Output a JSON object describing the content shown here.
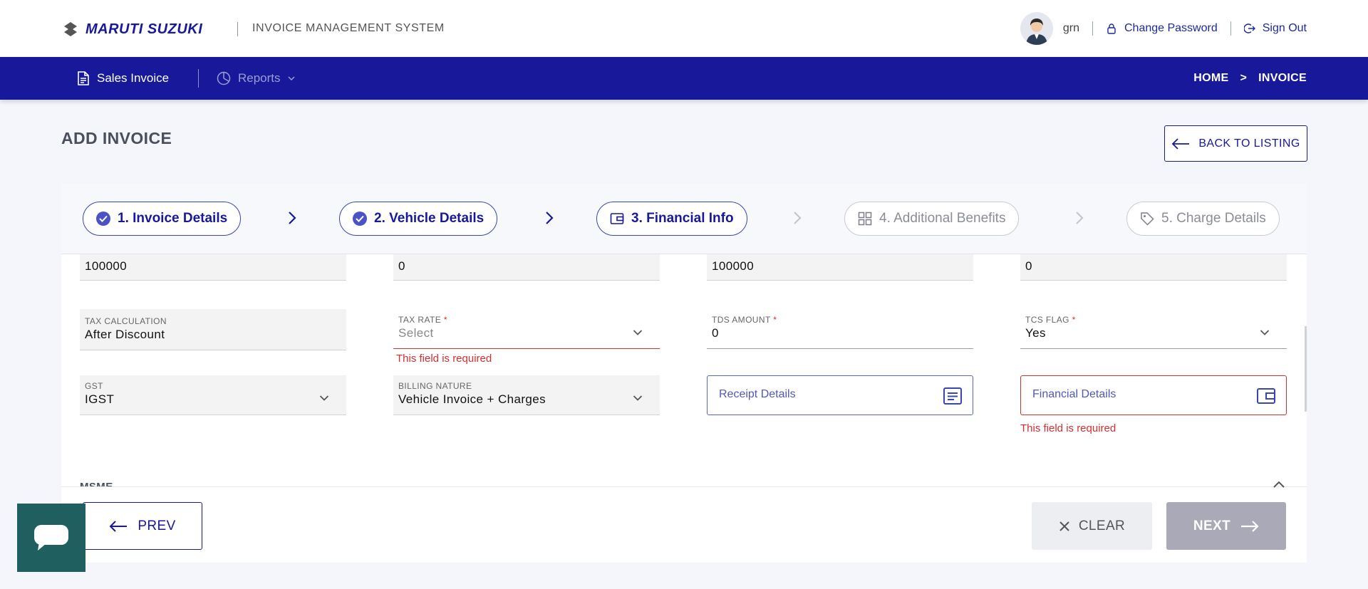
{
  "header": {
    "brand": "MARUTI SUZUKI",
    "app_title": "INVOICE MANAGEMENT SYSTEM",
    "username": "grn",
    "change_password": "Change Password",
    "sign_out": "Sign Out"
  },
  "nav": {
    "sales_invoice": "Sales Invoice",
    "reports": "Reports",
    "breadcrumb_home": "HOME",
    "breadcrumb_sep": ">",
    "breadcrumb_current": "INVOICE"
  },
  "page": {
    "title": "ADD INVOICE",
    "back_label": "BACK TO LISTING"
  },
  "steps": [
    {
      "label": "1. Invoice Details",
      "state": "completed"
    },
    {
      "label": "2. Vehicle Details",
      "state": "completed"
    },
    {
      "label": "3. Financial Info",
      "state": "active"
    },
    {
      "label": "4. Additional Benefits",
      "state": "disabled"
    },
    {
      "label": "5. Charge Details",
      "state": "disabled"
    }
  ],
  "form": {
    "row1": {
      "invoice_amount": "100000",
      "charge_amount": "0",
      "round_off": "100000",
      "outstanding_amount": "0"
    },
    "tax_calculation": {
      "label": "TAX CALCULATION",
      "value": "After Discount"
    },
    "tax_rate": {
      "label": "TAX RATE",
      "required": "*",
      "placeholder": "Select",
      "error": "This field is required"
    },
    "tds_amount": {
      "label": "TDS AMOUNT",
      "required": "*",
      "value": "0"
    },
    "tcs_flag": {
      "label": "TCS FLAG",
      "required": "*",
      "value": "Yes"
    },
    "gst": {
      "label": "GST",
      "value": "IGST"
    },
    "billing_nature": {
      "label": "BILLING NATURE",
      "value": "Vehicle Invoice + Charges"
    },
    "receipt_details": {
      "placeholder": "Receipt Details"
    },
    "financial_details": {
      "placeholder": "Financial Details",
      "error": "This field is required"
    }
  },
  "section": {
    "msme": "MSME"
  },
  "footer": {
    "prev": "PREV",
    "clear": "CLEAR",
    "next": "NEXT"
  },
  "colors": {
    "primary": "#17199a",
    "error": "#d32f2f",
    "disabled_button": "#a9a9b8",
    "chat_widget": "#1f5f5f"
  }
}
